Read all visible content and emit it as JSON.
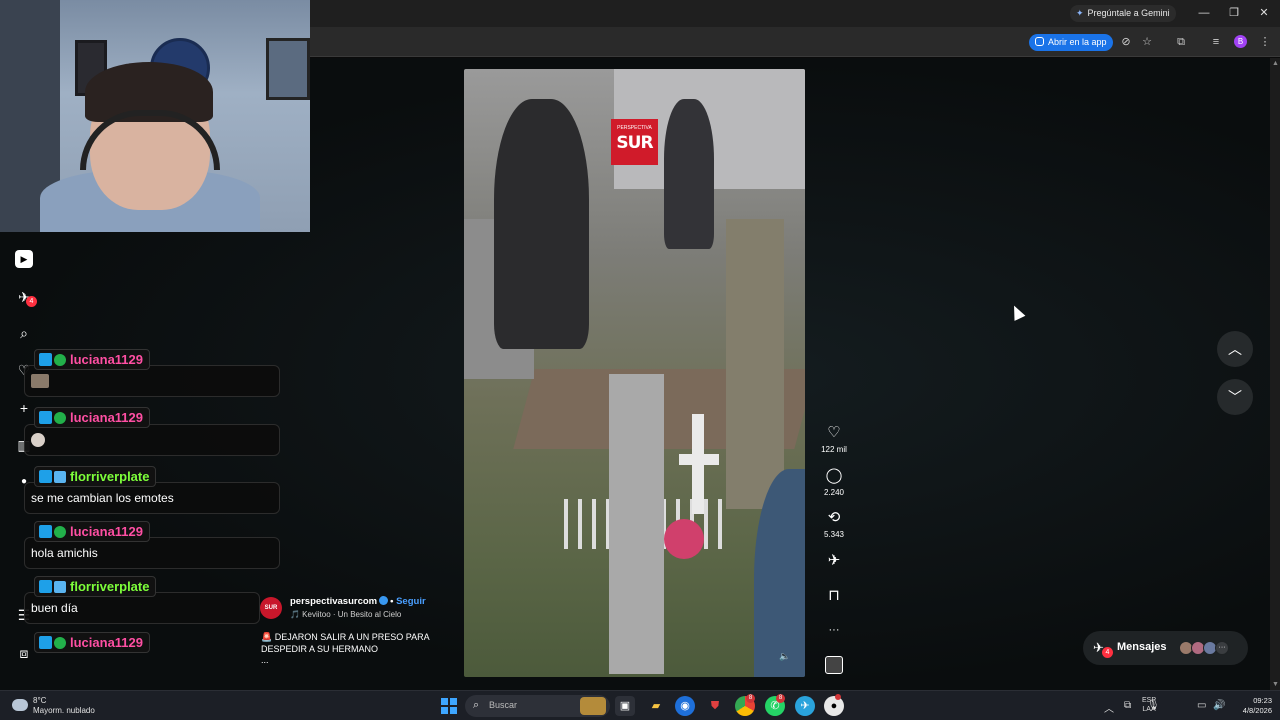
{
  "browser": {
    "gemini_label": "Pregúntale a Gemini",
    "open_app_label": "Abrir en la app",
    "profile_initial": "B"
  },
  "nav": {
    "notif_badge": "4"
  },
  "chat": [
    {
      "user": "luciana1129",
      "color": "#ff4fa3",
      "text": "",
      "emote": true
    },
    {
      "user": "luciana1129",
      "color": "#ff4fa3",
      "text": "",
      "emote": true
    },
    {
      "user": "florriverplate",
      "color": "#7dff3a",
      "text": "se me cambian los emotes",
      "emote": false
    },
    {
      "user": "luciana1129",
      "color": "#ff4fa3",
      "text": "hola amichis",
      "emote": false
    },
    {
      "user": "florriverplate",
      "color": "#7dff3a",
      "text": "buen día",
      "emote": false
    },
    {
      "user": "luciana1129",
      "color": "#ff4fa3",
      "text": "",
      "emote": false
    }
  ],
  "video": {
    "logo_top": "PERSPECTIVA",
    "logo_text": "SUR"
  },
  "post": {
    "avatar_text": "SUR",
    "author": "perspectivasurcom",
    "separator": "•",
    "follow_label": "Seguir",
    "music": "🎵 Keviitoo · Un Besito al Cielo",
    "caption": "🚨 DEJARON SALIR A UN PRESO PARA DESPEDIR A SU HERMANO",
    "caption_more": "..."
  },
  "actions": {
    "likes": "122 mil",
    "comments": "2.240",
    "reposts": "5.343",
    "more": "···"
  },
  "messages": {
    "label": "Mensajes",
    "badge": "4",
    "more": "···"
  },
  "taskbar": {
    "temp": "8°C",
    "weather": "Mayorm. nublado",
    "search_placeholder": "Buscar",
    "lang_1": "ESP",
    "lang_2": "LAA",
    "time": "09:23",
    "date": "4/8/2026",
    "badge_a": "8",
    "badge_b": "8"
  }
}
